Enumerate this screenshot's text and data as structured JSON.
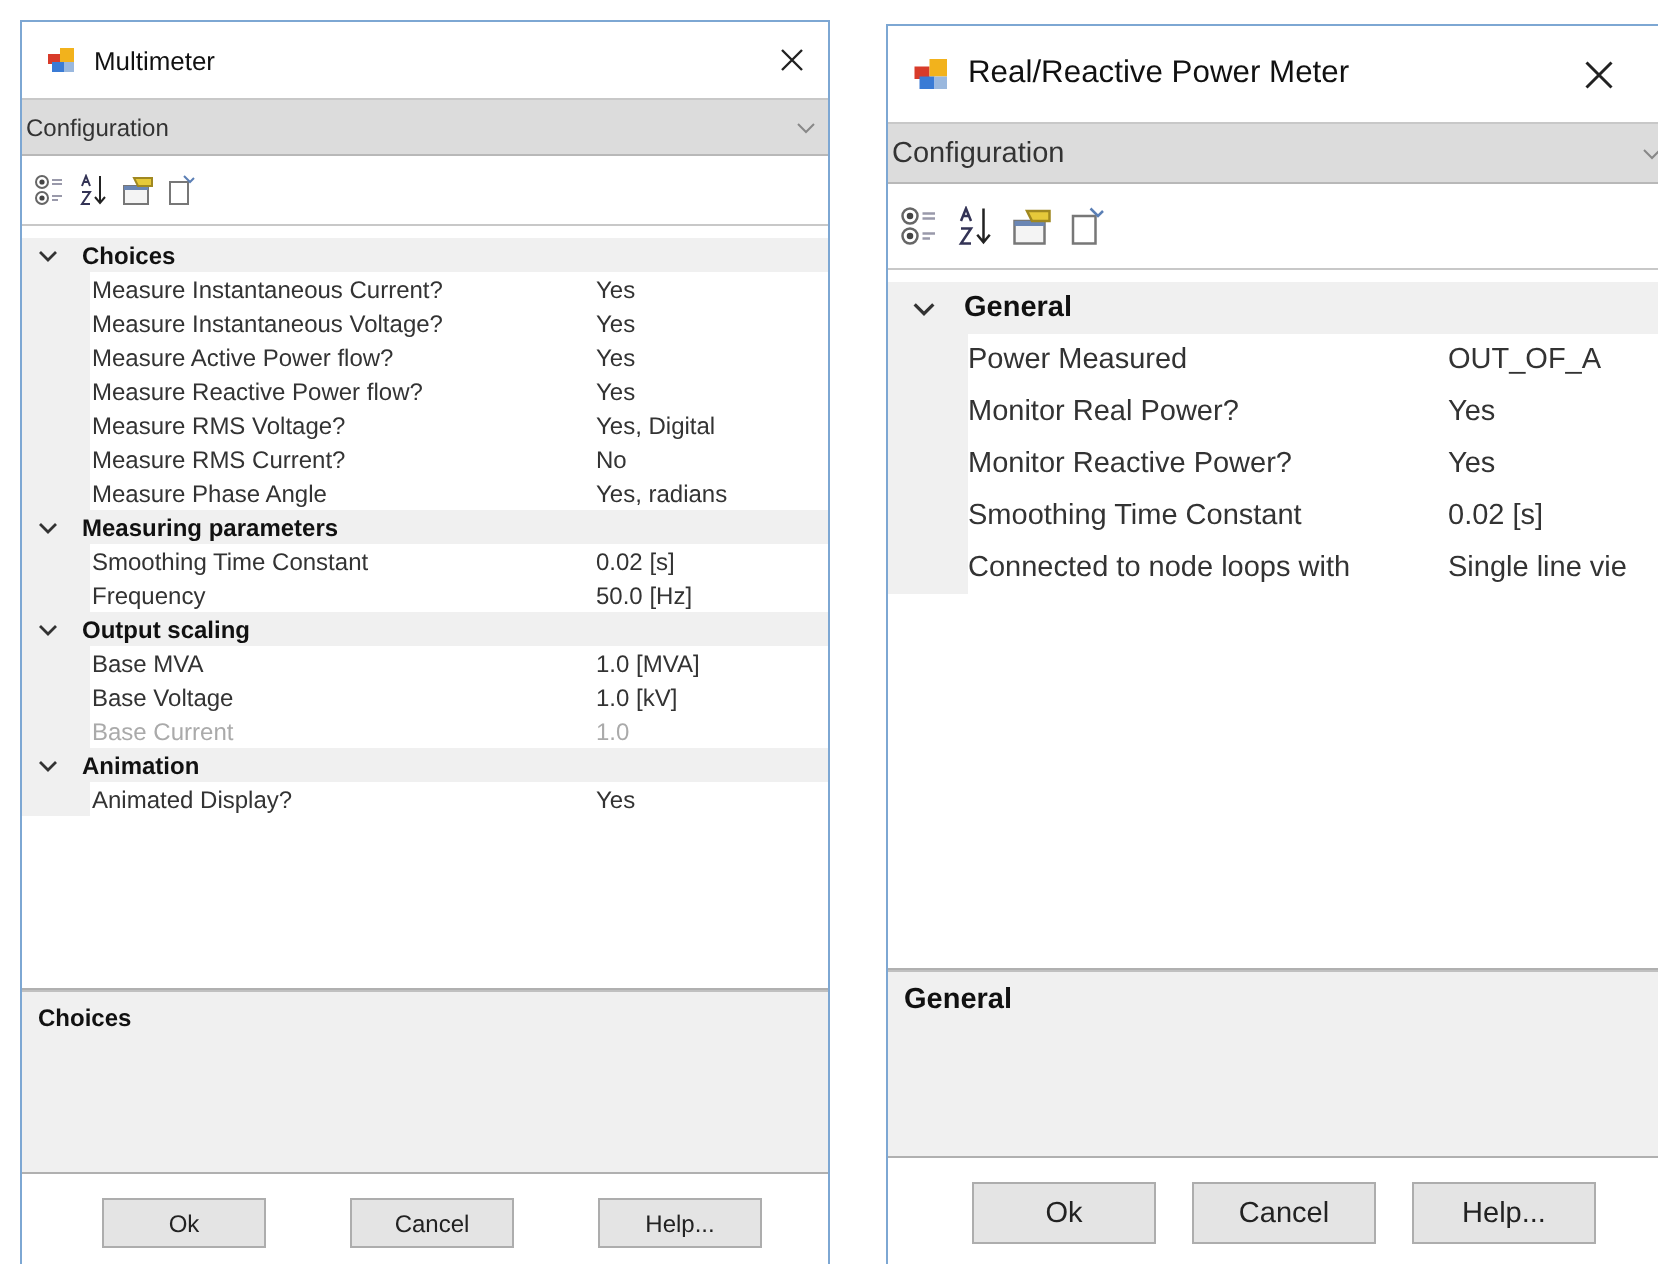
{
  "windows": [
    {
      "title": "Multimeter",
      "config": "Configuration",
      "categories": [
        {
          "name": "Choices",
          "expanded": true,
          "properties": [
            {
              "name": "Measure Instantaneous Current?",
              "value": "Yes",
              "disabled": false
            },
            {
              "name": "Measure Instantaneous Voltage?",
              "value": "Yes",
              "disabled": false
            },
            {
              "name": "Measure Active Power flow?",
              "value": "Yes",
              "disabled": false
            },
            {
              "name": "Measure Reactive Power flow?",
              "value": "Yes",
              "disabled": false
            },
            {
              "name": "Measure RMS Voltage?",
              "value": "Yes, Digital",
              "disabled": false
            },
            {
              "name": "Measure RMS Current?",
              "value": "No",
              "disabled": false
            },
            {
              "name": "Measure Phase Angle",
              "value": "Yes, radians",
              "disabled": false
            }
          ]
        },
        {
          "name": "Measuring parameters",
          "expanded": true,
          "properties": [
            {
              "name": "Smoothing Time Constant",
              "value": "0.02 [s]",
              "disabled": false
            },
            {
              "name": "Frequency",
              "value": "50.0 [Hz]",
              "disabled": false
            }
          ]
        },
        {
          "name": "Output scaling",
          "expanded": true,
          "properties": [
            {
              "name": "Base MVA",
              "value": "1.0 [MVA]",
              "disabled": false
            },
            {
              "name": "Base Voltage",
              "value": "1.0 [kV]",
              "disabled": false
            },
            {
              "name": "Base Current",
              "value": "1.0",
              "disabled": true
            }
          ]
        },
        {
          "name": "Animation",
          "expanded": true,
          "properties": [
            {
              "name": "Animated Display?",
              "value": "Yes",
              "disabled": false
            }
          ]
        }
      ],
      "description": "Choices",
      "buttons": [
        "Ok",
        "Cancel",
        "Help..."
      ]
    },
    {
      "title": "Real/Reactive Power Meter",
      "config": "Configuration",
      "categories": [
        {
          "name": "General",
          "expanded": true,
          "properties": [
            {
              "name": "Power Measured",
              "value": "OUT_OF_A",
              "disabled": false
            },
            {
              "name": "Monitor Real Power?",
              "value": "Yes",
              "disabled": false
            },
            {
              "name": "Monitor Reactive Power?",
              "value": "Yes",
              "disabled": false
            },
            {
              "name": "Smoothing Time Constant",
              "value": "0.02 [s]",
              "disabled": false
            },
            {
              "name": "Connected to node loops with",
              "value": "Single line vie",
              "disabled": false
            }
          ]
        }
      ],
      "description": "General",
      "buttons": [
        "Ok",
        "Cancel",
        "Help..."
      ]
    }
  ]
}
